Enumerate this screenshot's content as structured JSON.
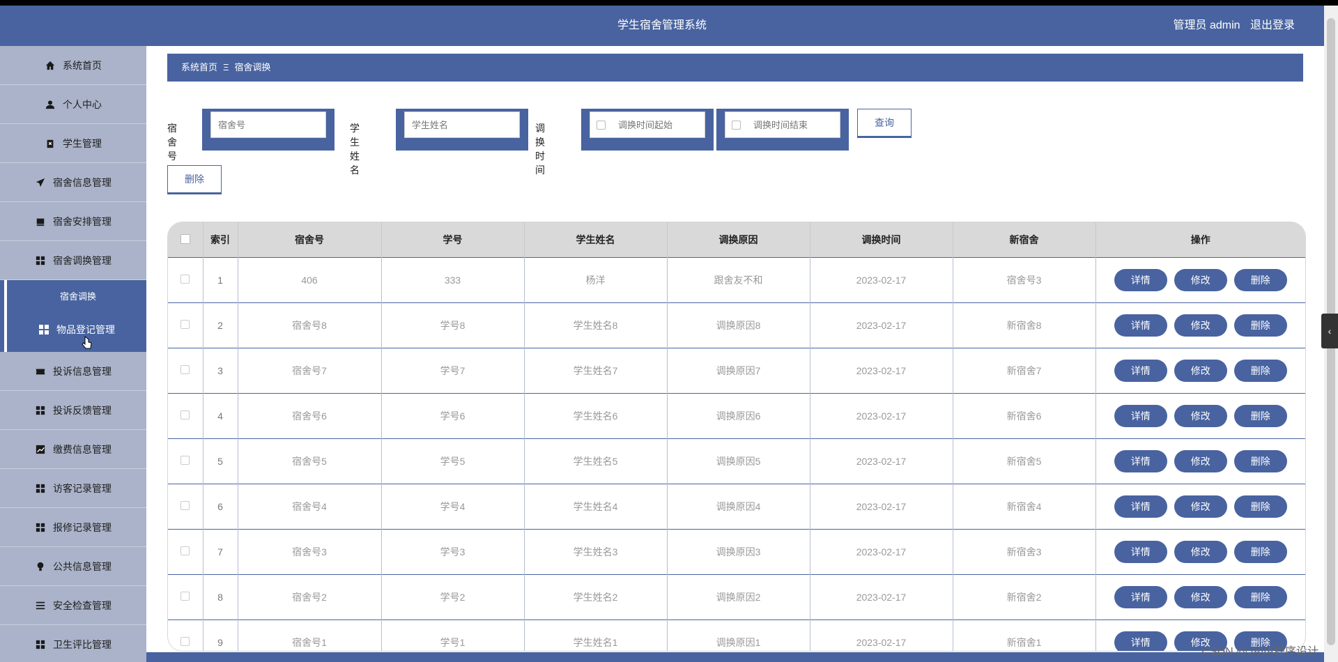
{
  "header": {
    "title": "学生宿舍管理系统",
    "user_label": "管理员 admin",
    "logout_label": "退出登录"
  },
  "sidebar": {
    "items": [
      {
        "label": "系统首页",
        "icon": "home-icon"
      },
      {
        "label": "个人中心",
        "icon": "user-icon"
      },
      {
        "label": "学生管理",
        "icon": "clipboard-icon"
      },
      {
        "label": "宿舍信息管理",
        "icon": "send-icon"
      },
      {
        "label": "宿舍安排管理",
        "icon": "inbox-icon"
      },
      {
        "label": "宿舍调换管理",
        "icon": "grid-icon"
      }
    ],
    "active_child": "宿舍调换",
    "active_parent": "物品登记管理",
    "items_after": [
      {
        "label": "投诉信息管理",
        "icon": "ticket-icon"
      },
      {
        "label": "投诉反馈管理",
        "icon": "grid-icon"
      },
      {
        "label": "缴费信息管理",
        "icon": "chart-icon"
      },
      {
        "label": "访客记录管理",
        "icon": "grid-icon"
      },
      {
        "label": "报修记录管理",
        "icon": "grid-icon"
      },
      {
        "label": "公共信息管理",
        "icon": "bulb-icon"
      },
      {
        "label": "安全检查管理",
        "icon": "list-icon"
      },
      {
        "label": "卫生评比管理",
        "icon": "grid-icon"
      }
    ]
  },
  "breadcrumb": {
    "home": "系统首页",
    "separator": "Ξ",
    "current": "宿舍调换"
  },
  "search": {
    "dorm_label": "宿舍号",
    "dorm_placeholder": "宿舍号",
    "name_label": "学生姓名",
    "name_placeholder": "学生姓名",
    "time_label": "调换时间",
    "start_placeholder": "调换时间起始",
    "end_placeholder": "调换时间结束",
    "query_label": "查询"
  },
  "actions": {
    "delete_label": "删除"
  },
  "table": {
    "headers": [
      "索引",
      "宿舍号",
      "学号",
      "学生姓名",
      "调换原因",
      "调换时间",
      "新宿舍",
      "操作"
    ],
    "rows": [
      [
        "1",
        "406",
        "333",
        "杨洋",
        "跟舍友不和",
        "2023-02-17",
        "宿舍号3"
      ],
      [
        "2",
        "宿舍号8",
        "学号8",
        "学生姓名8",
        "调换原因8",
        "2023-02-17",
        "新宿舍8"
      ],
      [
        "3",
        "宿舍号7",
        "学号7",
        "学生姓名7",
        "调换原因7",
        "2023-02-17",
        "新宿舍7"
      ],
      [
        "4",
        "宿舍号6",
        "学号6",
        "学生姓名6",
        "调换原因6",
        "2023-02-17",
        "新宿舍6"
      ],
      [
        "5",
        "宿舍号5",
        "学号5",
        "学生姓名5",
        "调换原因5",
        "2023-02-17",
        "新宿舍5"
      ],
      [
        "6",
        "宿舍号4",
        "学号4",
        "学生姓名4",
        "调换原因4",
        "2023-02-17",
        "新宿舍4"
      ],
      [
        "7",
        "宿舍号3",
        "学号3",
        "学生姓名3",
        "调换原因3",
        "2023-02-17",
        "新宿舍3"
      ],
      [
        "8",
        "宿舍号2",
        "学号2",
        "学生姓名2",
        "调换原因2",
        "2023-02-17",
        "新宿舍2"
      ],
      [
        "9",
        "宿舍号1",
        "学号1",
        "学生姓名1",
        "调换原因1",
        "2023-02-17",
        "新宿舍1"
      ]
    ],
    "row_actions": [
      "详情",
      "修改",
      "删除"
    ]
  },
  "watermark": "CSDN @JAVA程序设计",
  "colors": {
    "primary": "#4863a0",
    "sidebar": "#a7b0c7"
  }
}
